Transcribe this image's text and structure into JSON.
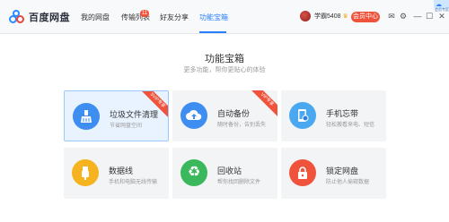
{
  "app": {
    "logo_text": "百度网盘"
  },
  "nav": {
    "items": [
      {
        "label": "我的网盘",
        "active": false
      },
      {
        "label": "传输列表",
        "active": false,
        "badge": "11"
      },
      {
        "label": "好友分享",
        "active": false
      },
      {
        "label": "功能宝箱",
        "active": true
      }
    ]
  },
  "user": {
    "name": "学霸5408",
    "member_button": "会员中心"
  },
  "top_icons": [
    "mail-icon",
    "settings-icon",
    "minimize-icon",
    "maximize-icon",
    "close-icon"
  ],
  "corner_badge": {
    "text": "会员专区"
  },
  "page": {
    "title": "功能宝箱",
    "subtitle": "更多功能，帮你更贴心的体验"
  },
  "cards": [
    {
      "title": "垃圾文件清理",
      "desc": "节省网盘空间",
      "icon": "broom-icon",
      "icon_color": "#3d8ef0",
      "ribbon": "SVIP专享",
      "highlight": true
    },
    {
      "title": "自动备份",
      "desc": "随时备份，告别丢失",
      "icon": "cloud-upload-icon",
      "icon_color": "#3d8ef0",
      "ribbon": "VIP专享",
      "highlight": false
    },
    {
      "title": "手机忘带",
      "desc": "轻松搬看来电、短信",
      "icon": "phone-icon",
      "icon_color": "#4aa8f0",
      "ribbon": "",
      "highlight": false
    },
    {
      "title": "数据线",
      "desc": "手机和电脑无线传输",
      "icon": "usb-icon",
      "icon_color": "#f5b320",
      "ribbon": "",
      "highlight": false
    },
    {
      "title": "回收站",
      "desc": "帮你找回删除文件",
      "icon": "recycle-icon",
      "icon_color": "#3cb85c",
      "ribbon": "",
      "highlight": false
    },
    {
      "title": "锁定网盘",
      "desc": "防止他人偷窥数据",
      "icon": "lock-icon",
      "icon_color": "#f0533c",
      "ribbon": "",
      "highlight": false
    }
  ]
}
